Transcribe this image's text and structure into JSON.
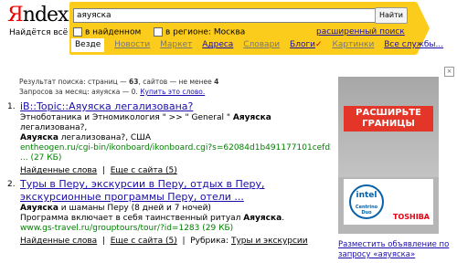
{
  "logo": {
    "first": "Я",
    "rest": "ndex"
  },
  "tagline": "Найдётся всё",
  "search": {
    "value": "аяуяска",
    "button": "Найти"
  },
  "options": {
    "in_found": "в найденном",
    "in_region": "в регионе: Москва",
    "advanced": "расширенный поиск"
  },
  "tabs": [
    {
      "label": "Везде"
    },
    {
      "label": "Новости"
    },
    {
      "label": "Маркет"
    },
    {
      "label": "Адреса"
    },
    {
      "label": "Словари"
    },
    {
      "label": "Блоги"
    },
    {
      "label": "Картинки"
    },
    {
      "label": "Все службы..."
    }
  ],
  "stats": {
    "line1_pre": "Результат поиска: страниц — ",
    "pages": "63",
    "line1_mid": ", сайтов — не менее ",
    "sites": "4",
    "line2_pre": "Запросов за месяц: аяуяска — 0. ",
    "buy": "Купить это слово."
  },
  "results": [
    {
      "num": "1.",
      "title": "iB::Topic::Аяуяска легализована?",
      "snippet1": "Этноботаника и Этномикология \" >> \" General \" ",
      "hl1": "Аяуяска",
      "snippet1b": " легализована?,",
      "snippet2a": "",
      "hl2": "Аяуяска",
      "snippet2b": " легализована?, США",
      "url": "entheogen.ru/cgi-bin/ikonboard/ikonboard.cgi?s=62084d1b491177101cefd20",
      "size": "... (27 КБ)",
      "links": [
        "Найденные слова",
        "Еще с сайта (5)"
      ]
    },
    {
      "num": "2.",
      "title": "Туры в Перу, экскурсии в Перу, отдых в Перу, экскурсионные программы Перу, отели ...",
      "snippet1": "",
      "hl1": "Аяуяска",
      "snippet1b": " и шаманы Перу (8 дней и 7 ночей)",
      "snippet2a": "Программа включает в себя таинственный ритуал ",
      "hl2": "Аяуяска",
      "snippet2b": ".",
      "url": "www.gs-travel.ru/grouptours/tour/?id=1283",
      "size": " (29 КБ)",
      "links": [
        "Найденные слова",
        "Еще с сайта (5)"
      ],
      "rubric_label": "Рубрика:",
      "rubric": "Туры и экскурсии"
    }
  ],
  "ad": {
    "banner": "РАСШИРЬТЕ ГРАНИЦЫ",
    "intel": "intel",
    "centrino": "Centrino Duo",
    "toshiba": "TOSHIBA",
    "link": "Разместить объявление по запросу «аяуяска»"
  },
  "colors": {
    "panel": "#fccc1c",
    "link": "#1a0dab",
    "url": "#008000",
    "logo_red": "#e00"
  }
}
